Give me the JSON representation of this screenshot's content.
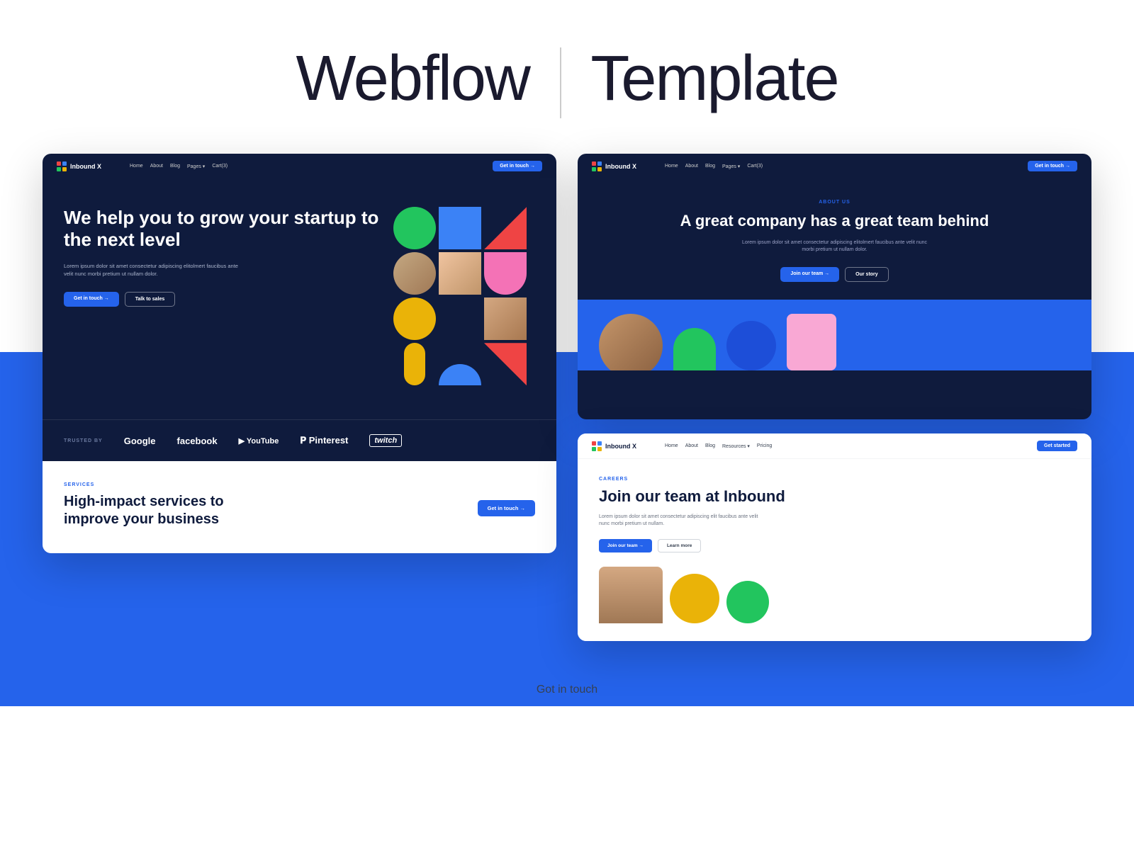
{
  "header": {
    "title_left": "Webflow",
    "title_right": "Template"
  },
  "left_preview": {
    "nav": {
      "brand": "Inbound X",
      "links": [
        "Home",
        "About",
        "Blog",
        "Pages ▾",
        "Cart(3)"
      ],
      "cta": "Get in touch →"
    },
    "hero": {
      "title": "We help you to grow your startup to the next level",
      "description": "Lorem ipsum dolor sit amet consectetur adipiscing elitolmert faucibus ante velit nunc morbi pretium ut nullam dolor.",
      "btn_primary": "Get in touch →",
      "btn_outline": "Talk to sales"
    },
    "trusted": {
      "label": "TRUSTED BY",
      "brands": [
        "Google",
        "facebook",
        "▶ YouTube",
        "𝐏 Pinterest",
        "twitch"
      ]
    },
    "services": {
      "tag": "SERVICES",
      "title": "High-impact services to improve your business",
      "cta": "Get in touch →"
    }
  },
  "right_top_preview": {
    "nav": {
      "brand": "Inbound X",
      "links": [
        "Home",
        "About",
        "Blog",
        "Pages ▾",
        "Cart(3)"
      ],
      "cta": "Get in touch →"
    },
    "about": {
      "tag": "ABOUT US",
      "title": "A great company has a great team behind",
      "description": "Lorem ipsum dolor sit amet consectetur adipiscing elitolmert faucibus ante velit nunc morbi pretium ut nullam dolor.",
      "btn_primary": "Join our team →",
      "btn_outline": "Our story"
    }
  },
  "right_bottom_preview": {
    "nav": {
      "brand": "Inbound X",
      "links": [
        "Home",
        "About",
        "Blog",
        "Resources ▾",
        "Pricing"
      ],
      "cta": "Get started"
    },
    "careers": {
      "tag": "CAREERS",
      "title": "Join our team at Inbound",
      "description": "Lorem ipsum dolor sit amet consectetur adipiscing elit faucibus ante velit nunc morbi pretium ut nullam.",
      "btn_primary": "Join our team →",
      "btn_outline": "Learn more"
    }
  },
  "bottom": {
    "got_in_touch": "Got in touch"
  }
}
